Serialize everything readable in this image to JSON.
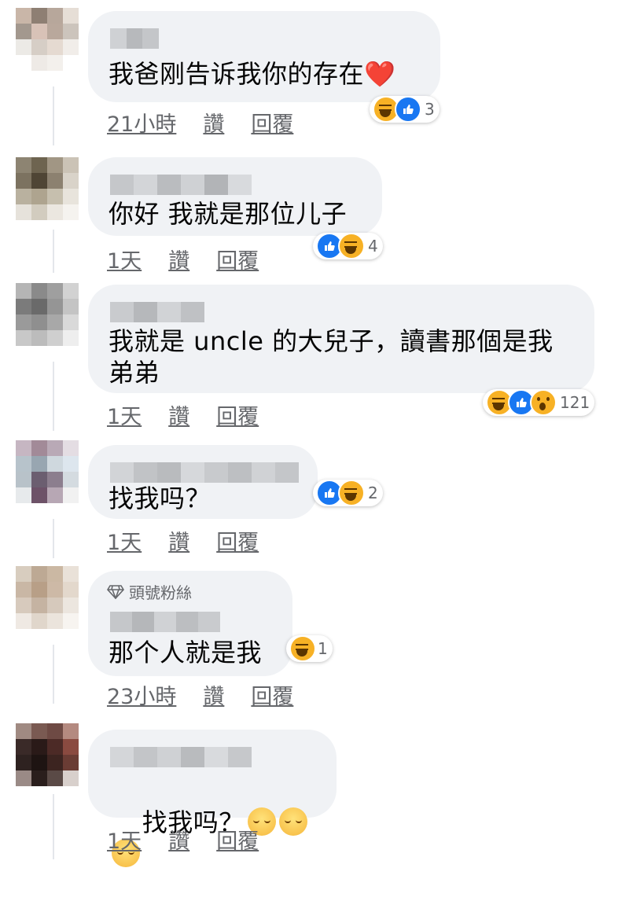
{
  "comments": [
    {
      "text": "我爸刚告诉我你的存在",
      "emoji_suffix": "❤️",
      "time": "21小時",
      "like": "讚",
      "reply": "回覆",
      "reactions": [
        "haha-icon",
        "like-icon"
      ],
      "reaction_count": "3"
    },
    {
      "text": "你好 我就是那位儿子",
      "time": "1天",
      "like": "讚",
      "reply": "回覆",
      "reactions": [
        "like-icon",
        "haha-icon"
      ],
      "reaction_count": "4"
    },
    {
      "text": "我就是 uncle 的大兒子，讀書那個是我\n弟弟",
      "time": "1天",
      "like": "讚",
      "reply": "回覆",
      "reactions": [
        "haha-icon",
        "like-icon",
        "wow-icon"
      ],
      "reaction_count": "121"
    },
    {
      "text": "找我吗？",
      "time": "1天",
      "like": "讚",
      "reply": "回覆",
      "reactions": [
        "like-icon",
        "haha-icon"
      ],
      "reaction_count": "2"
    },
    {
      "badge": "頭號粉絲",
      "text": "那个人就是我",
      "time": "23小時",
      "like": "讚",
      "reply": "回覆",
      "reactions": [
        "haha-icon"
      ],
      "reaction_count": "1"
    },
    {
      "text": "找我吗？",
      "emoji_count": 3,
      "time": "1天",
      "like": "讚",
      "reply": "回覆"
    }
  ],
  "colors": {
    "bubble": "#f0f2f5",
    "meta_text": "#65676b",
    "like_blue": "#1877f2",
    "haha_yellow": "#f7b125"
  }
}
